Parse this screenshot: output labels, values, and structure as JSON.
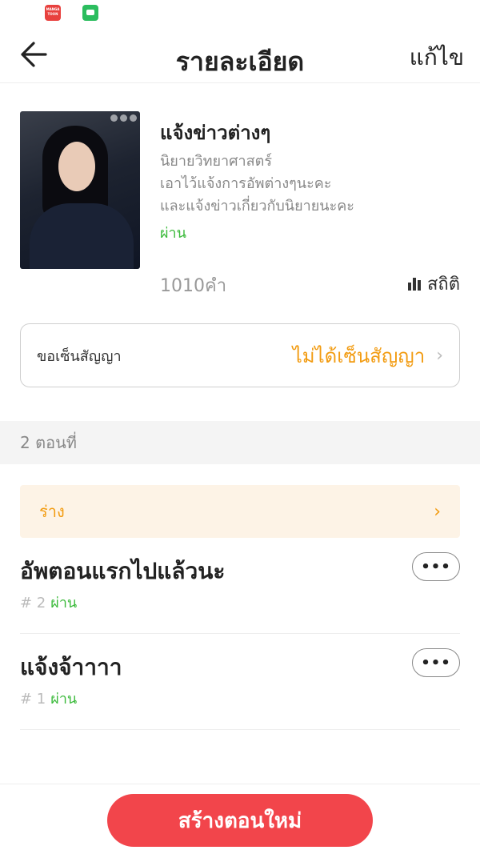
{
  "header": {
    "title": "รายละเอียด",
    "edit_label": "แก้ไข"
  },
  "status_bar": {
    "icons": [
      "manga-toon-app-icon",
      "line-chat-app-icon"
    ],
    "manga_icon_text": "MANGA TOON"
  },
  "book": {
    "title": "แจ้งข่าวต่างๆ",
    "genre": "นิยายวิทยาศาสตร์",
    "description_line1": "เอาไว้แจ้งการอัพต่างๆนะคะ",
    "description_line2": "และแจ้งข่าวเกี่ยวกับนิยายนะคะ",
    "status": "ผ่าน",
    "word_count": "1010คำ",
    "stats_label": "สถิติ"
  },
  "contract": {
    "label": "ขอเซ็นสัญญา",
    "value": "ไม่ได้เซ็นสัญญา"
  },
  "chapters": {
    "header": "2 ตอนที่",
    "draft_label": "ร่าง",
    "items": [
      {
        "title": "อัพตอนแรกไปแล้วนะ",
        "number": "# 2",
        "status": "ผ่าน"
      },
      {
        "title": "แจ้งจ้าาาา",
        "number": "# 1",
        "status": "ผ่าน"
      }
    ],
    "more_label": "•••"
  },
  "footer": {
    "create_label": "สร้างตอนใหม่"
  },
  "colors": {
    "accent_red": "#f2454b",
    "orange": "#f29b10",
    "green_status": "#3bba3b"
  }
}
